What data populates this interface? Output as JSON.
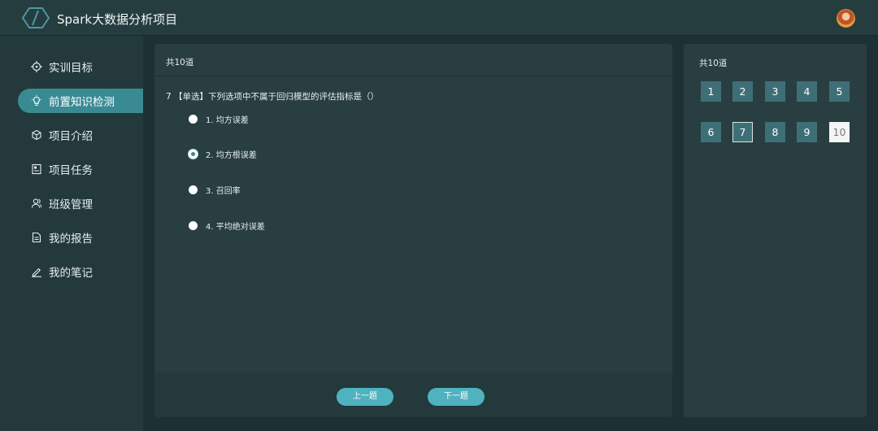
{
  "header": {
    "app_title": "Spark大数据分析项目"
  },
  "sidebar": {
    "items": [
      {
        "label": "实训目标",
        "icon": "target-icon"
      },
      {
        "label": "前置知识检测",
        "icon": "lightbulb-icon",
        "active": true
      },
      {
        "label": "项目介绍",
        "icon": "cube-icon"
      },
      {
        "label": "项目任务",
        "icon": "task-icon"
      },
      {
        "label": "班级管理",
        "icon": "users-icon"
      },
      {
        "label": "我的报告",
        "icon": "report-icon"
      },
      {
        "label": "我的笔记",
        "icon": "pen-icon"
      }
    ]
  },
  "main": {
    "total_label": "共10道",
    "question": "7 【单选】下列选项中不属于回归模型的评估指标是（）",
    "options": [
      {
        "label": "1. 均方误差",
        "checked": false
      },
      {
        "label": "2. 均方根误差",
        "checked": true
      },
      {
        "label": "3. 召回率",
        "checked": false
      },
      {
        "label": "4. 平均绝对误差",
        "checked": false
      }
    ],
    "prev_label": "上一题",
    "next_label": "下一题"
  },
  "answer_sheet": {
    "total_label": "共10道",
    "numbers": [
      "1",
      "2",
      "3",
      "4",
      "5",
      "6",
      "7",
      "8",
      "9",
      "10"
    ],
    "current": "7",
    "unanswered": "10"
  },
  "colors": {
    "accent": "#3a8a94",
    "button": "#4fb2bf",
    "box": "#3f6f76"
  }
}
